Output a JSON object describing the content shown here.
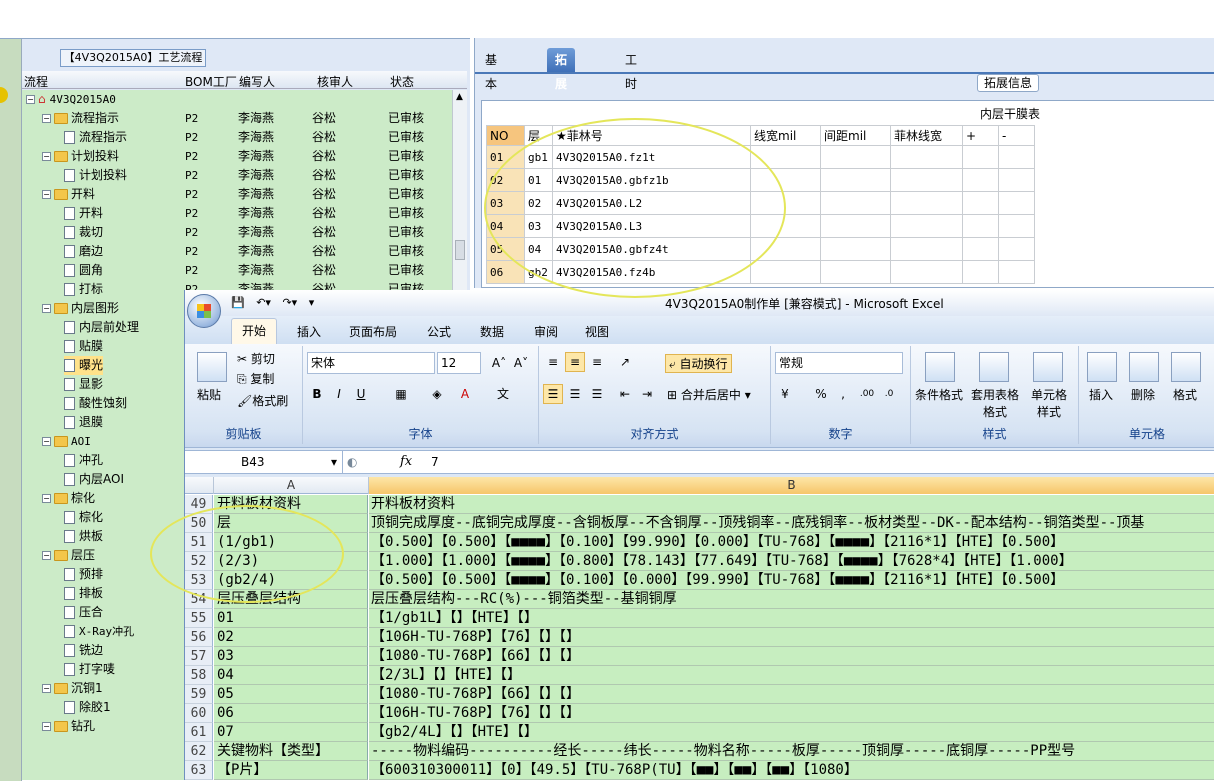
{
  "left_panel": {
    "title": "【4V3Q2015A0】工艺流程",
    "columns": [
      "流程",
      "BOM工厂",
      "编写人",
      "核审人",
      "状态"
    ],
    "rows": [
      {
        "level": 0,
        "kind": "root",
        "name": "4V3Q2015A0",
        "factory": "",
        "writer": "",
        "reviewer": "",
        "status": ""
      },
      {
        "level": 1,
        "kind": "folder",
        "name": "流程指示",
        "factory": "P2",
        "writer": "李海燕",
        "reviewer": "谷松",
        "status": "已审核"
      },
      {
        "level": 2,
        "kind": "doc",
        "name": "流程指示",
        "factory": "P2",
        "writer": "李海燕",
        "reviewer": "谷松",
        "status": "已审核"
      },
      {
        "level": 1,
        "kind": "folder",
        "name": "计划投料",
        "factory": "P2",
        "writer": "李海燕",
        "reviewer": "谷松",
        "status": "已审核"
      },
      {
        "level": 2,
        "kind": "doc",
        "name": "计划投料",
        "factory": "P2",
        "writer": "李海燕",
        "reviewer": "谷松",
        "status": "已审核"
      },
      {
        "level": 1,
        "kind": "folder",
        "name": "开料",
        "factory": "P2",
        "writer": "李海燕",
        "reviewer": "谷松",
        "status": "已审核"
      },
      {
        "level": 2,
        "kind": "doc",
        "name": "开料",
        "factory": "P2",
        "writer": "李海燕",
        "reviewer": "谷松",
        "status": "已审核"
      },
      {
        "level": 2,
        "kind": "doc",
        "name": "裁切",
        "factory": "P2",
        "writer": "李海燕",
        "reviewer": "谷松",
        "status": "已审核"
      },
      {
        "level": 2,
        "kind": "doc",
        "name": "磨边",
        "factory": "P2",
        "writer": "李海燕",
        "reviewer": "谷松",
        "status": "已审核"
      },
      {
        "level": 2,
        "kind": "doc",
        "name": "圆角",
        "factory": "P2",
        "writer": "李海燕",
        "reviewer": "谷松",
        "status": "已审核"
      },
      {
        "level": 2,
        "kind": "doc",
        "name": "打标",
        "factory": "P2",
        "writer": "李海燕",
        "reviewer": "谷松",
        "status": "已审核"
      },
      {
        "level": 1,
        "kind": "folder",
        "name": "内层图形",
        "factory": "",
        "writer": "",
        "reviewer": "",
        "status": ""
      },
      {
        "level": 2,
        "kind": "doc",
        "name": "内层前处理",
        "factory": "",
        "writer": "",
        "reviewer": "",
        "status": ""
      },
      {
        "level": 2,
        "kind": "doc",
        "name": "贴膜",
        "factory": "",
        "writer": "",
        "reviewer": "",
        "status": ""
      },
      {
        "level": 2,
        "kind": "doc",
        "name": "曝光",
        "factory": "",
        "writer": "",
        "reviewer": "",
        "status": "",
        "selected": true
      },
      {
        "level": 2,
        "kind": "doc",
        "name": "显影",
        "factory": "",
        "writer": "",
        "reviewer": "",
        "status": ""
      },
      {
        "level": 2,
        "kind": "doc",
        "name": "酸性蚀刻",
        "factory": "",
        "writer": "",
        "reviewer": "",
        "status": ""
      },
      {
        "level": 2,
        "kind": "doc",
        "name": "退膜",
        "factory": "",
        "writer": "",
        "reviewer": "",
        "status": ""
      },
      {
        "level": 1,
        "kind": "folder",
        "name": "AOI",
        "factory": "",
        "writer": "",
        "reviewer": "",
        "status": ""
      },
      {
        "level": 2,
        "kind": "doc",
        "name": "冲孔",
        "factory": "",
        "writer": "",
        "reviewer": "",
        "status": ""
      },
      {
        "level": 2,
        "kind": "doc",
        "name": "内层AOI",
        "factory": "",
        "writer": "",
        "reviewer": "",
        "status": ""
      },
      {
        "level": 1,
        "kind": "folder",
        "name": "棕化",
        "factory": "",
        "writer": "",
        "reviewer": "",
        "status": ""
      },
      {
        "level": 2,
        "kind": "doc",
        "name": "棕化",
        "factory": "",
        "writer": "",
        "reviewer": "",
        "status": ""
      },
      {
        "level": 2,
        "kind": "doc",
        "name": "烘板",
        "factory": "",
        "writer": "",
        "reviewer": "",
        "status": ""
      },
      {
        "level": 1,
        "kind": "folder",
        "name": "层压",
        "factory": "",
        "writer": "",
        "reviewer": "",
        "status": ""
      },
      {
        "level": 2,
        "kind": "doc",
        "name": "预排",
        "factory": "",
        "writer": "",
        "reviewer": "",
        "status": ""
      },
      {
        "level": 2,
        "kind": "doc",
        "name": "排板",
        "factory": "",
        "writer": "",
        "reviewer": "",
        "status": ""
      },
      {
        "level": 2,
        "kind": "doc",
        "name": "压合",
        "factory": "",
        "writer": "",
        "reviewer": "",
        "status": ""
      },
      {
        "level": 2,
        "kind": "doc",
        "name": "X-Ray冲孔",
        "factory": "",
        "writer": "",
        "reviewer": "",
        "status": ""
      },
      {
        "level": 2,
        "kind": "doc",
        "name": "铣边",
        "factory": "",
        "writer": "",
        "reviewer": "",
        "status": ""
      },
      {
        "level": 2,
        "kind": "doc",
        "name": "打字唛",
        "factory": "",
        "writer": "",
        "reviewer": "",
        "status": ""
      },
      {
        "level": 1,
        "kind": "folder",
        "name": "沉铜1",
        "factory": "",
        "writer": "",
        "reviewer": "",
        "status": ""
      },
      {
        "level": 2,
        "kind": "doc",
        "name": "除胶1",
        "factory": "",
        "writer": "",
        "reviewer": "",
        "status": ""
      },
      {
        "level": 1,
        "kind": "folder",
        "name": "钻孔",
        "factory": "",
        "writer": "",
        "reviewer": "",
        "status": ""
      }
    ]
  },
  "right_panel": {
    "tabs": [
      "基本信息",
      "拓展信息",
      "工时"
    ],
    "active_tab": "拓展信息",
    "group_label": "拓展信息",
    "table_caption": "内层干膜表",
    "columns": [
      "NO",
      "层",
      "★菲林号",
      "线宽mil",
      "间距mil",
      "菲林线宽",
      "+",
      "-"
    ],
    "rows": [
      [
        "01",
        "gb1",
        "4V3Q2015A0.fz1t",
        "",
        "",
        "",
        "",
        ""
      ],
      [
        "02",
        "01",
        "4V3Q2015A0.gbfz1b",
        "",
        "",
        "",
        "",
        ""
      ],
      [
        "03",
        "02",
        "4V3Q2015A0.L2",
        "",
        "",
        "",
        "",
        ""
      ],
      [
        "04",
        "03",
        "4V3Q2015A0.L3",
        "",
        "",
        "",
        "",
        ""
      ],
      [
        "05",
        "04",
        "4V3Q2015A0.gbfz4t",
        "",
        "",
        "",
        "",
        ""
      ],
      [
        "06",
        "gb2",
        "4V3Q2015A0.fz4b",
        "",
        "",
        "",
        "",
        ""
      ]
    ]
  },
  "excel": {
    "title": "4V3Q2015A0制作单 [兼容模式] - Microsoft Excel",
    "menu": [
      "开始",
      "插入",
      "页面布局",
      "公式",
      "数据",
      "审阅",
      "视图"
    ],
    "active_menu": "开始",
    "clipboard": {
      "paste": "粘贴",
      "cut": "剪切",
      "copy": "复制",
      "format_painter": "格式刷",
      "label": "剪贴板"
    },
    "font": {
      "name": "宋体",
      "size": "12",
      "label": "字体"
    },
    "alignment": {
      "wrap": "自动换行",
      "merge": "合并后居中",
      "label": "对齐方式"
    },
    "number": {
      "format": "常规",
      "label": "数字"
    },
    "styles": {
      "conditional": "条件格式",
      "table": "套用表格格式",
      "cell": "单元格样式",
      "label": "样式"
    },
    "cells": {
      "insert": "插入",
      "delete": "删除",
      "format": "格式",
      "label": "单元格"
    },
    "name_box": "B43",
    "formula_value": "7",
    "col_a": "A",
    "col_b": "B",
    "rows": [
      {
        "n": "49",
        "a": "开料板材资料",
        "b": "开料板材资料"
      },
      {
        "n": "50",
        "a": "层",
        "b": "顶铜完成厚度--底铜完成厚度--含铜板厚--不含铜厚--顶残铜率--底残铜率--板材类型--DK--配本结构--铜箔类型--顶基"
      },
      {
        "n": "51",
        "a": "(1/gb1)",
        "b": "【0.500】【0.500】【■■■■】【0.100】【99.990】【0.000】【TU-768】【■■■■】【2116*1】【HTE】【0.500】"
      },
      {
        "n": "52",
        "a": "(2/3)",
        "b": "【1.000】【1.000】【■■■■】【0.800】【78.143】【77.649】【TU-768】【■■■■】【7628*4】【HTE】【1.000】"
      },
      {
        "n": "53",
        "a": "(gb2/4)",
        "b": "【0.500】【0.500】【■■■■】【0.100】【0.000】【99.990】【TU-768】【■■■■】【2116*1】【HTE】【0.500】"
      },
      {
        "n": "54",
        "a": "层压叠层结构",
        "b": "层压叠层结构---RC(%)---铜箔类型--基铜铜厚"
      },
      {
        "n": "55",
        "a": "01",
        "b": "【1/gb1L】【】【HTE】【】"
      },
      {
        "n": "56",
        "a": "02",
        "b": "【106H-TU-768P】【76】【】【】"
      },
      {
        "n": "57",
        "a": "03",
        "b": "【1080-TU-768P】【66】【】【】"
      },
      {
        "n": "58",
        "a": "04",
        "b": "【2/3L】【】【HTE】【】"
      },
      {
        "n": "59",
        "a": "05",
        "b": "【1080-TU-768P】【66】【】【】"
      },
      {
        "n": "60",
        "a": "06",
        "b": "【106H-TU-768P】【76】【】【】"
      },
      {
        "n": "61",
        "a": "07",
        "b": "【gb2/4L】【】【HTE】【】"
      },
      {
        "n": "62",
        "a": "关键物料【类型】",
        "b": "-----物料编码----------经长-----纬长-----物料名称-----板厚-----顶铜厚-----底铜厚-----PP型号"
      },
      {
        "n": "63",
        "a": "【P片】",
        "b": "【600310300011】【0】【49.5】【TU-768P(TU】【■■】【■■】【■■】【1080】"
      }
    ]
  }
}
